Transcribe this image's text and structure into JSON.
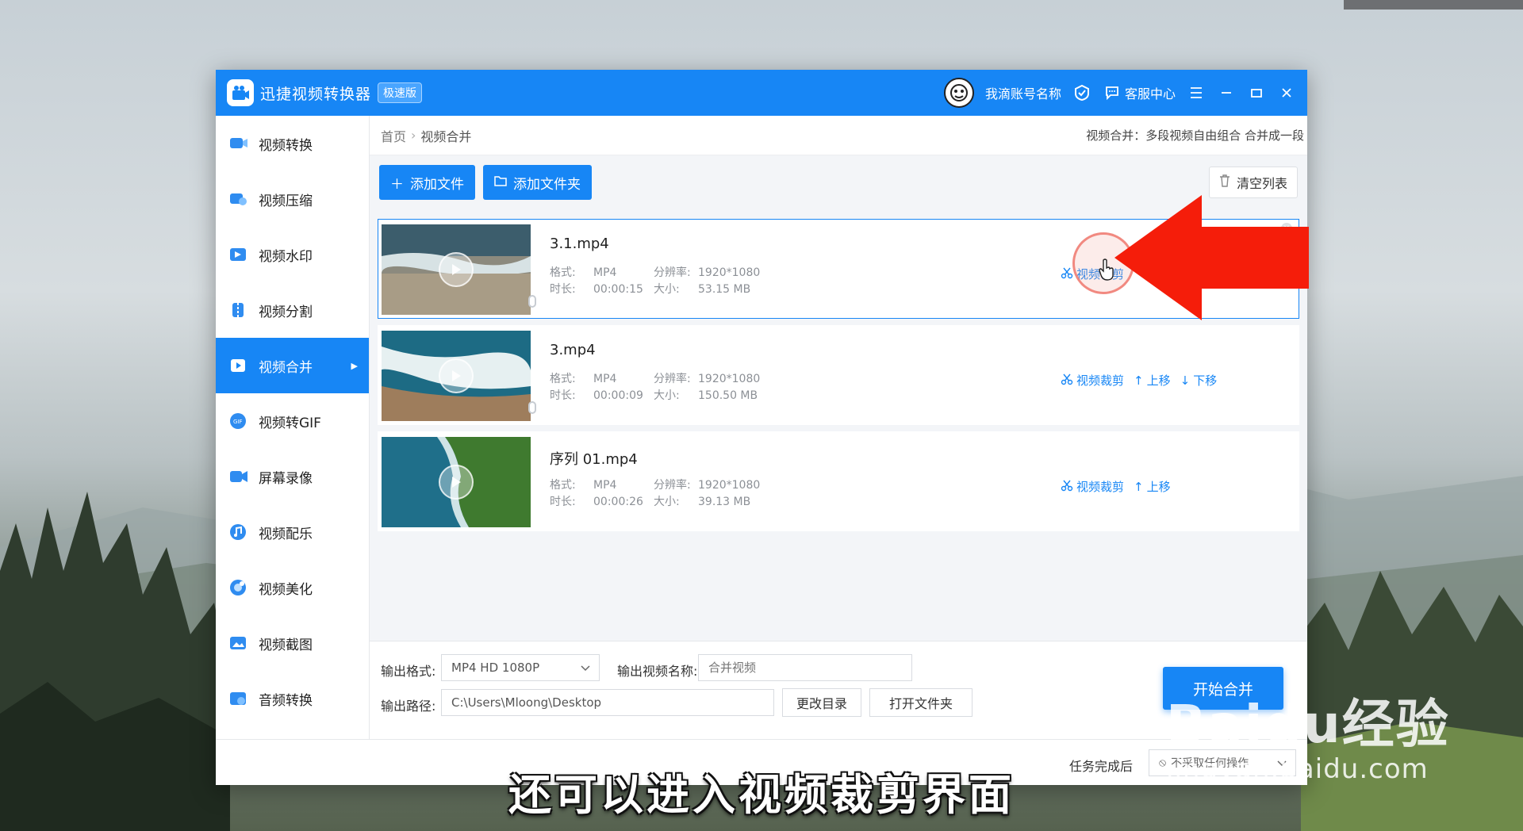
{
  "app": {
    "title": "迅捷视频转换器",
    "badge": "极速版",
    "account": "我滴账号名称",
    "service": "客服中心"
  },
  "sidebar": {
    "items": [
      {
        "label": "视频转换",
        "icon": "video-convert-icon"
      },
      {
        "label": "视频压缩",
        "icon": "video-compress-icon"
      },
      {
        "label": "视频水印",
        "icon": "video-watermark-icon"
      },
      {
        "label": "视频分割",
        "icon": "video-split-icon"
      },
      {
        "label": "视频合并",
        "icon": "video-merge-icon",
        "active": true
      },
      {
        "label": "视频转GIF",
        "icon": "gif-icon"
      },
      {
        "label": "屏幕录像",
        "icon": "screen-record-icon"
      },
      {
        "label": "视频配乐",
        "icon": "music-icon"
      },
      {
        "label": "视频美化",
        "icon": "beautify-icon"
      },
      {
        "label": "视频截图",
        "icon": "screenshot-icon"
      },
      {
        "label": "音频转换",
        "icon": "audio-convert-icon"
      }
    ]
  },
  "breadcrumb": {
    "home": "首页",
    "current": "视频合并",
    "tip": "视频合并：多段视频自由组合 合并成一段"
  },
  "toolbar": {
    "add_file": "添加文件",
    "add_folder": "添加文件夹",
    "clear_list": "清空列表"
  },
  "meta_labels": {
    "format": "格式:",
    "resolution": "分辨率:",
    "duration": "时长:",
    "size": "大小:"
  },
  "actions": {
    "trim": "视频裁剪",
    "up": "上移",
    "down": "下移"
  },
  "files": [
    {
      "name": "3.1.mp4",
      "format": "MP4",
      "resolution": "1920*1080",
      "duration": "00:00:15",
      "size": "53.15 MB"
    },
    {
      "name": "3.mp4",
      "format": "MP4",
      "resolution": "1920*1080",
      "duration": "00:00:09",
      "size": "150.50 MB"
    },
    {
      "name": "序列 01.mp4",
      "format": "MP4",
      "resolution": "1920*1080",
      "duration": "00:00:26",
      "size": "39.13 MB"
    }
  ],
  "output": {
    "format_label": "输出格式:",
    "format_value": "MP4   HD 1080P",
    "name_label": "输出视频名称:",
    "name_placeholder": "合并视频",
    "path_label": "输出路径:",
    "path_value": "C:\\Users\\Mloong\\Desktop",
    "change_dir": "更改目录",
    "open_folder": "打开文件夹",
    "start": "开始合并"
  },
  "footer": {
    "after_label": "任务完成后",
    "after_value": "不采取任何操作"
  },
  "subtitle": "还可以进入视频裁剪界面",
  "watermark": {
    "main": "Baidu经验",
    "sub": "jingyan.baidu.com"
  },
  "colors": {
    "accent": "#1786f5",
    "arrow": "#f51d0a"
  }
}
